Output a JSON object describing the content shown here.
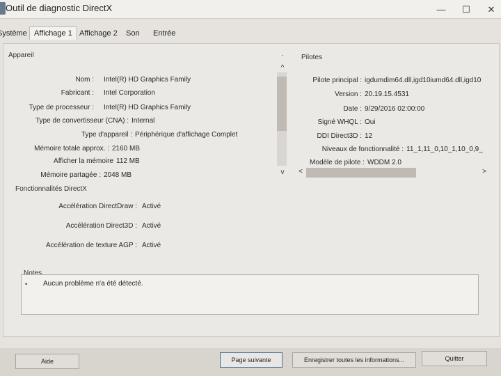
{
  "window": {
    "title": "Outil de diagnostic DirectX",
    "minimize_glyph": "—",
    "maximize_glyph": "☐",
    "close_glyph": "✕"
  },
  "tabs": [
    "Système",
    "Affichage 1",
    "Affichage 2",
    "Son",
    "Entrée"
  ],
  "active_tab": "Affichage 1",
  "device": {
    "heading": "Appareil",
    "rows": [
      {
        "label": "Nom :",
        "value": "Intel(R) HD Graphics Family"
      },
      {
        "label": "Fabricant :",
        "value": "Intel Corporation"
      },
      {
        "label": "Type de processeur :",
        "value": "Intel(R) HD Graphics Family"
      },
      {
        "label": "Type de convertisseur (CNA) :",
        "value": "Internal"
      },
      {
        "label": "Type d'appareil :",
        "value": "Périphérique d'affichage Complet"
      },
      {
        "label": "Mémoire totale approx. :",
        "value": "2160 MB"
      },
      {
        "label": "Afficher la mémoire",
        "value": "112 MB"
      },
      {
        "label": "Mémoire partagée :",
        "value": "2048 MB"
      }
    ]
  },
  "drivers": {
    "heading": "Pilotes",
    "rows": [
      {
        "label": "Pilote principal :",
        "value": "igdumdim64.dll,igd10iumd64.dll,igd10"
      },
      {
        "label": "Version :",
        "value": "20.19.15.4531"
      },
      {
        "label": "Date :",
        "value": "9/29/2016 02:00:00"
      },
      {
        "label": "Signé WHQL :",
        "value": "Oui"
      },
      {
        "label": "DDI Direct3D :",
        "value": "12"
      },
      {
        "label": "Niveaux de fonctionnalité :",
        "value": "11_1,11_0,10_1,10_0,9_"
      },
      {
        "label": "Modèle de pilote :",
        "value": "WDDM 2.0"
      }
    ]
  },
  "features": {
    "heading": "Fonctionnalités DirectX",
    "rows": [
      {
        "label": "Accélération DirectDraw :",
        "value": "Activé"
      },
      {
        "label": "Accélération Direct3D :",
        "value": "Activé"
      },
      {
        "label": "Accélération de texture AGP :",
        "value": "Activé"
      }
    ]
  },
  "notes": {
    "heading": "Notes",
    "items": [
      "Aucun problème n'a été détecté."
    ]
  },
  "buttons": {
    "help": "Aide",
    "next_page": "Page suivante",
    "save_all": "Enregistrer toutes les informations...",
    "quit": "Quitter"
  },
  "scroll_glyphs": {
    "up": "^",
    "down": "v",
    "left": "<",
    "right": ">"
  }
}
